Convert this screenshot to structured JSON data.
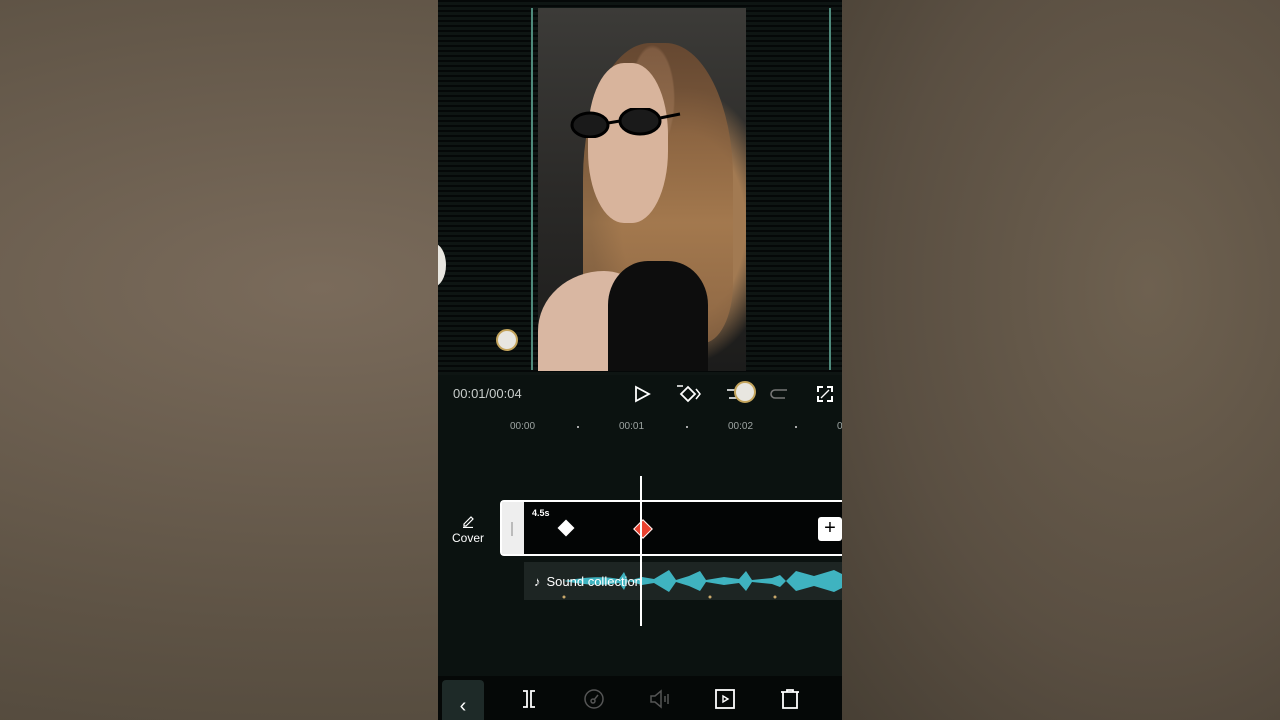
{
  "player": {
    "time": "00:01/00:04"
  },
  "ruler": {
    "ticks": [
      "00:00",
      "00:01",
      "00:02",
      "0"
    ]
  },
  "timeline": {
    "cover_label": "Cover",
    "clip_duration": "4.5s",
    "audio_label": "Sound collection"
  },
  "colors": {
    "accent_keyframe": "#e8412f",
    "waveform": "#3fb3c0",
    "guide": "#4f8a7c"
  },
  "icons": [
    "play-icon",
    "keyframe-icon",
    "undo-icon",
    "redo-icon",
    "fullscreen-icon",
    "edit-icon",
    "music-note-icon",
    "split-icon",
    "speed-icon",
    "volume-icon",
    "animation-icon",
    "delete-icon",
    "back-chevron-icon"
  ]
}
